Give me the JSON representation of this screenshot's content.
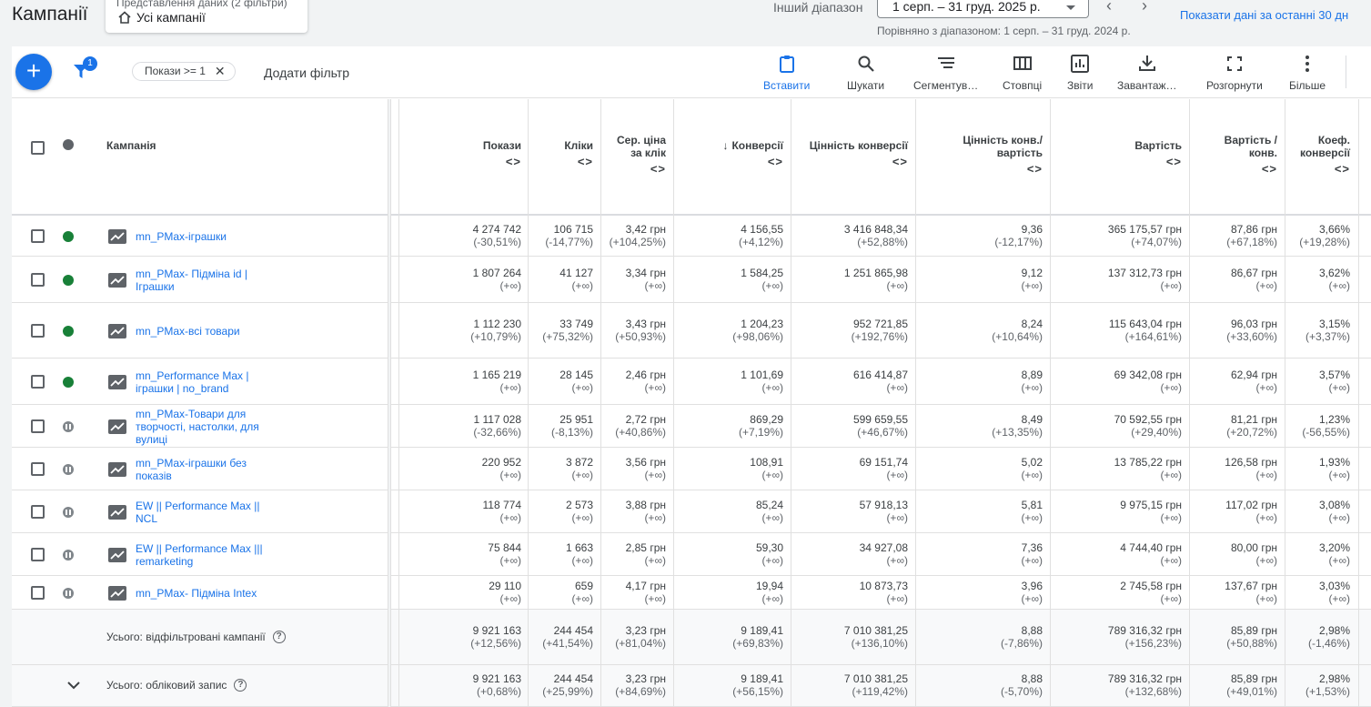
{
  "header": {
    "title": "Кампанії",
    "view_sub": "Представлення даних (2 фільтри)",
    "view_main": "Усі кампанії",
    "date_label": "Інший діапазон",
    "date_range": "1 серп. – 31 груд. 2025 р.",
    "compare": "Порівняно з діапазоном: 1 серп. – 31 груд. 2024 р.",
    "show_last": "Показати дані за останні 30 дн"
  },
  "toolbar": {
    "filter_badge": "1",
    "chip": "Покази >= 1",
    "add_filter": "Додати фільтр",
    "tools": [
      "Вставити",
      "Шукати",
      "Сегментув…",
      "Стовпці",
      "Звіти",
      "Завантаж…",
      "Розгорнути",
      "Більше"
    ]
  },
  "columns": {
    "campaign": "Кампанія",
    "impr": "Покази",
    "clicks": "Кліки",
    "cpc": [
      "Сер. ціна",
      "за клік"
    ],
    "conv": "Конверсії",
    "conv_value": "Цінність конверсії",
    "value_cost": [
      "Цінність конв./",
      "вартість"
    ],
    "cost": "Вартість",
    "cost_conv": [
      "Вартість /",
      "конв."
    ],
    "conv_rate": [
      "Коеф.",
      "конверсії"
    ],
    "sort_icon": "<>",
    "sort_arrow": "↓"
  },
  "rows": [
    {
      "name": "mn_PMax-іграшки",
      "status": "green",
      "v": [
        [
          "4 274 742",
          "(-30,51%)"
        ],
        [
          "106 715",
          "(-14,77%)"
        ],
        [
          "3,42 грн",
          "(+104,25%)"
        ],
        [
          "4 156,55",
          "(+4,12%)"
        ],
        [
          "3 416 848,34",
          "(+52,88%)"
        ],
        [
          "9,36",
          "(-12,17%)"
        ],
        [
          "365 175,57 грн",
          "(+74,07%)"
        ],
        [
          "87,86 грн",
          "(+67,18%)"
        ],
        [
          "3,66%",
          "(+19,28%)"
        ]
      ]
    },
    {
      "name": "mn_PMax- Підміна id | Іграшки",
      "status": "green",
      "v": [
        [
          "1 807 264",
          "(+∞)"
        ],
        [
          "41 127",
          "(+∞)"
        ],
        [
          "3,34 грн",
          "(+∞)"
        ],
        [
          "1 584,25",
          "(+∞)"
        ],
        [
          "1 251 865,98",
          "(+∞)"
        ],
        [
          "9,12",
          "(+∞)"
        ],
        [
          "137 312,73 грн",
          "(+∞)"
        ],
        [
          "86,67 грн",
          "(+∞)"
        ],
        [
          "3,62%",
          "(+∞)"
        ]
      ]
    },
    {
      "name": "mn_PMax-всі товари",
      "status": "green",
      "v": [
        [
          "1 112 230",
          "(+10,79%)"
        ],
        [
          "33 749",
          "(+75,32%)"
        ],
        [
          "3,43 грн",
          "(+50,93%)"
        ],
        [
          "1 204,23",
          "(+98,06%)"
        ],
        [
          "952 721,85",
          "(+192,76%)"
        ],
        [
          "8,24",
          "(+10,64%)"
        ],
        [
          "115 643,04 грн",
          "(+164,61%)"
        ],
        [
          "96,03 грн",
          "(+33,60%)"
        ],
        [
          "3,15%",
          "(+3,37%)"
        ]
      ]
    },
    {
      "name": "mn_Performance Max | іграшки | no_brand",
      "status": "green",
      "v": [
        [
          "1 165 219",
          "(+∞)"
        ],
        [
          "28 145",
          "(+∞)"
        ],
        [
          "2,46 грн",
          "(+∞)"
        ],
        [
          "1 101,69",
          "(+∞)"
        ],
        [
          "616 414,87",
          "(+∞)"
        ],
        [
          "8,89",
          "(+∞)"
        ],
        [
          "69 342,08 грн",
          "(+∞)"
        ],
        [
          "62,94 грн",
          "(+∞)"
        ],
        [
          "3,57%",
          "(+∞)"
        ]
      ]
    },
    {
      "name": "mn_PMax-Товари для творчості, настолки, для вулиці",
      "status": "paused",
      "v": [
        [
          "1 117 028",
          "(-32,66%)"
        ],
        [
          "25 951",
          "(-8,13%)"
        ],
        [
          "2,72 грн",
          "(+40,86%)"
        ],
        [
          "869,29",
          "(+7,19%)"
        ],
        [
          "599 659,55",
          "(+46,67%)"
        ],
        [
          "8,49",
          "(+13,35%)"
        ],
        [
          "70 592,55 грн",
          "(+29,40%)"
        ],
        [
          "81,21 грн",
          "(+20,72%)"
        ],
        [
          "1,23%",
          "(-56,55%)"
        ]
      ]
    },
    {
      "name": "mn_PMax-іграшки без показів",
      "status": "paused",
      "v": [
        [
          "220 952",
          "(+∞)"
        ],
        [
          "3 872",
          "(+∞)"
        ],
        [
          "3,56 грн",
          "(+∞)"
        ],
        [
          "108,91",
          "(+∞)"
        ],
        [
          "69 151,74",
          "(+∞)"
        ],
        [
          "5,02",
          "(+∞)"
        ],
        [
          "13 785,22 грн",
          "(+∞)"
        ],
        [
          "126,58 грн",
          "(+∞)"
        ],
        [
          "1,93%",
          "(+∞)"
        ]
      ]
    },
    {
      "name": "EW || Performance Max || NCL",
      "status": "paused",
      "v": [
        [
          "118 774",
          "(+∞)"
        ],
        [
          "2 573",
          "(+∞)"
        ],
        [
          "3,88 грн",
          "(+∞)"
        ],
        [
          "85,24",
          "(+∞)"
        ],
        [
          "57 918,13",
          "(+∞)"
        ],
        [
          "5,81",
          "(+∞)"
        ],
        [
          "9 975,15 грн",
          "(+∞)"
        ],
        [
          "117,02 грн",
          "(+∞)"
        ],
        [
          "3,08%",
          "(+∞)"
        ]
      ]
    },
    {
      "name": "EW || Performance Max ||| remarketing",
      "status": "paused",
      "v": [
        [
          "75 844",
          "(+∞)"
        ],
        [
          "1 663",
          "(+∞)"
        ],
        [
          "2,85 грн",
          "(+∞)"
        ],
        [
          "59,30",
          "(+∞)"
        ],
        [
          "34 927,08",
          "(+∞)"
        ],
        [
          "7,36",
          "(+∞)"
        ],
        [
          "4 744,40 грн",
          "(+∞)"
        ],
        [
          "80,00 грн",
          "(+∞)"
        ],
        [
          "3,20%",
          "(+∞)"
        ]
      ]
    },
    {
      "name": "mn_PMax- Підміна Intex",
      "status": "paused",
      "v": [
        [
          "29 110",
          "(+∞)"
        ],
        [
          "659",
          "(+∞)"
        ],
        [
          "4,17 грн",
          "(+∞)"
        ],
        [
          "19,94",
          "(+∞)"
        ],
        [
          "10 873,73",
          "(+∞)"
        ],
        [
          "3,96",
          "(+∞)"
        ],
        [
          "2 745,58 грн",
          "(+∞)"
        ],
        [
          "137,67 грн",
          "(+∞)"
        ],
        [
          "3,03%",
          "(+∞)"
        ]
      ]
    }
  ],
  "totals": [
    {
      "label": "Усього: відфільтровані кампанії",
      "v": [
        [
          "9 921 163",
          "(+12,56%)"
        ],
        [
          "244 454",
          "(+41,54%)"
        ],
        [
          "3,23 грн",
          "(+81,04%)"
        ],
        [
          "9 189,41",
          "(+69,83%)"
        ],
        [
          "7 010 381,25",
          "(+136,10%)"
        ],
        [
          "8,88",
          "(-7,86%)"
        ],
        [
          "789 316,32 грн",
          "(+156,23%)"
        ],
        [
          "85,89 грн",
          "(+50,88%)"
        ],
        [
          "2,98%",
          "(-1,46%)"
        ]
      ]
    },
    {
      "label": "Усього: обліковий запис",
      "v": [
        [
          "9 921 163",
          "(+0,68%)"
        ],
        [
          "244 454",
          "(+25,99%)"
        ],
        [
          "3,23 грн",
          "(+84,69%)"
        ],
        [
          "9 189,41",
          "(+56,15%)"
        ],
        [
          "7 010 381,25",
          "(+119,42%)"
        ],
        [
          "8,88",
          "(-5,70%)"
        ],
        [
          "789 316,32 грн",
          "(+132,68%)"
        ],
        [
          "85,89 грн",
          "(+49,01%)"
        ],
        [
          "2,98%",
          "(+1,53%)"
        ]
      ]
    }
  ]
}
